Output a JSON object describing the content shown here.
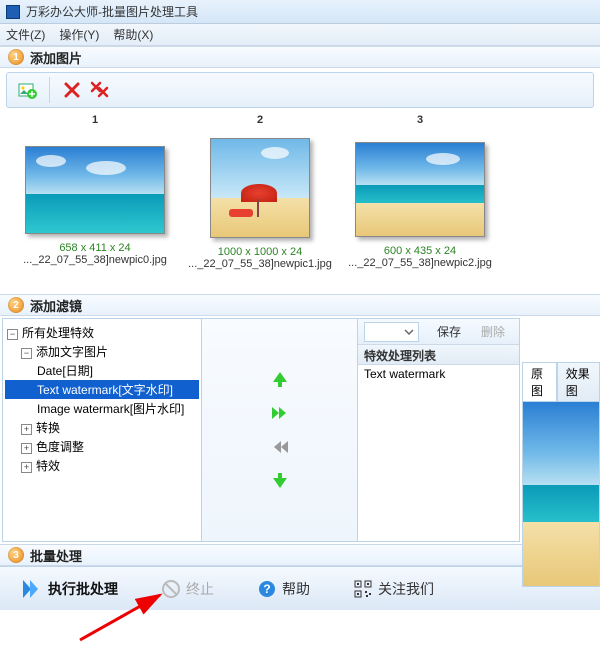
{
  "titlebar": {
    "title": "万彩办公大师-批量图片处理工具"
  },
  "menubar": {
    "file": "文件(Z)",
    "action": "操作(Y)",
    "help": "帮助(X)"
  },
  "section1": {
    "title": "添加图片",
    "step": "1",
    "cols": {
      "c1": "1",
      "c2": "2",
      "c3": "3"
    },
    "thumbs": {
      "t1": {
        "dims": "658 x 411 x 24",
        "fname": "..._22_07_55_38]newpic0.jpg"
      },
      "t2": {
        "dims": "1000 x 1000 x 24",
        "fname": "..._22_07_55_38]newpic1.jpg"
      },
      "t3": {
        "dims": "600 x 435 x 24",
        "fname": "..._22_07_55_38]newpic2.jpg"
      }
    }
  },
  "section2": {
    "title": "添加滤镜",
    "step": "2",
    "tree": {
      "root": "所有处理特效",
      "n1": "添加文字图片",
      "n1a": "Date[日期]",
      "n1b": "Text watermark[文字水印]",
      "n1c": "Image watermark[图片水印]",
      "n2": "转换",
      "n3": "色度调整",
      "n4": "特效"
    },
    "right": {
      "save": "保存",
      "del": "删除",
      "listHeader": "特效处理列表",
      "item1": "Text watermark"
    },
    "preview": {
      "tab1": "原图",
      "tab2": "效果图"
    }
  },
  "section3": {
    "title": "批量处理",
    "step": "3",
    "btn_execute": "执行批处理",
    "btn_stop": "终止",
    "btn_help": "帮助",
    "btn_follow": "关注我们"
  }
}
